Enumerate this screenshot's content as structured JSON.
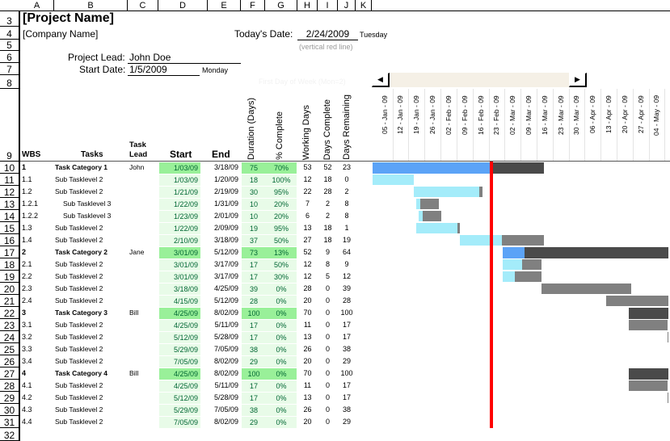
{
  "columns": [
    "A",
    "B",
    "C",
    "D",
    "E",
    "F",
    "G",
    "H",
    "I",
    "J",
    "K"
  ],
  "row_numbers": [
    "3",
    "4",
    "5",
    "6",
    "7",
    "8",
    "9",
    "10",
    "11",
    "12",
    "13",
    "14",
    "15",
    "16",
    "17",
    "18",
    "19",
    "20",
    "21",
    "22",
    "23",
    "24",
    "25",
    "26",
    "27",
    "28",
    "29",
    "30",
    "31",
    "32"
  ],
  "header": {
    "project_name": "[Project Name]",
    "company_name": "[Company Name]",
    "todays_date_label": "Today's Date:",
    "todays_date": "2/24/2009",
    "todays_day": "Tuesday",
    "red_line_note": "(vertical red line)",
    "project_lead_label": "Project Lead:",
    "project_lead": "John Doe",
    "start_date_label": "Start Date:",
    "start_date": "1/5/2009",
    "start_day": "Monday",
    "first_day_of_week": "First Day of Week (Mon=2)"
  },
  "table_headers": {
    "wbs": "WBS",
    "tasks": "Tasks",
    "task_lead": "Task Lead",
    "start": "Start",
    "end": "End",
    "duration": "Duration (Days)",
    "pct_complete": "% Complete",
    "working_days": "Working Days",
    "days_complete": "Days Complete",
    "days_remaining": "Days Remaining"
  },
  "timeline": {
    "today": "2009-02-24",
    "weeks": [
      "05 - Jan - 09",
      "12 - Jan - 09",
      "19 - Jan - 09",
      "26 - Jan - 09",
      "02 - Feb - 09",
      "09 - Feb - 09",
      "16 - Feb - 09",
      "23 - Feb - 09",
      "02 - Mar - 09",
      "09 - Mar - 09",
      "16 - Mar - 09",
      "23 - Mar - 09",
      "30 - Mar - 09",
      "06 - Apr - 09",
      "13 - Apr - 09",
      "20 - Apr - 09",
      "27 - Apr - 09",
      "04 - May - 09"
    ]
  },
  "colors": {
    "category_done": "#5ba3f7",
    "category_remaining": "#4a4a4a",
    "task_done": "#a4ecfa",
    "task_remaining": "#808080",
    "today_line": "#ff0000",
    "category_fill": "#99f099",
    "task_fill": "#e8fbe8"
  },
  "tasks": [
    {
      "wbs": "1",
      "name": "Task Category 1",
      "lead": "John",
      "start": "1/03/09",
      "end": "3/18/09",
      "duration": "75",
      "pct": "70%",
      "working": "53",
      "done": "52",
      "remaining": "23",
      "level": 1
    },
    {
      "wbs": "1.1",
      "name": "Sub Tasklevel 2",
      "lead": "",
      "start": "1/03/09",
      "end": "1/20/09",
      "duration": "18",
      "pct": "100%",
      "working": "12",
      "done": "18",
      "remaining": "0",
      "level": 2
    },
    {
      "wbs": "1.2",
      "name": "Sub Tasklevel 2",
      "lead": "",
      "start": "1/21/09",
      "end": "2/19/09",
      "duration": "30",
      "pct": "95%",
      "working": "22",
      "done": "28",
      "remaining": "2",
      "level": 2
    },
    {
      "wbs": "1.2.1",
      "name": "Sub Tasklevel 3",
      "lead": "",
      "start": "1/22/09",
      "end": "1/31/09",
      "duration": "10",
      "pct": "20%",
      "working": "7",
      "done": "2",
      "remaining": "8",
      "level": 3
    },
    {
      "wbs": "1.2.2",
      "name": "Sub Tasklevel 3",
      "lead": "",
      "start": "1/23/09",
      "end": "2/01/09",
      "duration": "10",
      "pct": "20%",
      "working": "6",
      "done": "2",
      "remaining": "8",
      "level": 3
    },
    {
      "wbs": "1.3",
      "name": "Sub Tasklevel 2",
      "lead": "",
      "start": "1/22/09",
      "end": "2/09/09",
      "duration": "19",
      "pct": "95%",
      "working": "13",
      "done": "18",
      "remaining": "1",
      "level": 2
    },
    {
      "wbs": "1.4",
      "name": "Sub Tasklevel 2",
      "lead": "",
      "start": "2/10/09",
      "end": "3/18/09",
      "duration": "37",
      "pct": "50%",
      "working": "27",
      "done": "18",
      "remaining": "19",
      "level": 2
    },
    {
      "wbs": "2",
      "name": "Task Category 2",
      "lead": "Jane",
      "start": "3/01/09",
      "end": "5/12/09",
      "duration": "73",
      "pct": "13%",
      "working": "52",
      "done": "9",
      "remaining": "64",
      "level": 1
    },
    {
      "wbs": "2.1",
      "name": "Sub Tasklevel 2",
      "lead": "",
      "start": "3/01/09",
      "end": "3/17/09",
      "duration": "17",
      "pct": "50%",
      "working": "12",
      "done": "8",
      "remaining": "9",
      "level": 2
    },
    {
      "wbs": "2.2",
      "name": "Sub Tasklevel 2",
      "lead": "",
      "start": "3/01/09",
      "end": "3/17/09",
      "duration": "17",
      "pct": "30%",
      "working": "12",
      "done": "5",
      "remaining": "12",
      "level": 2
    },
    {
      "wbs": "2.3",
      "name": "Sub Tasklevel 2",
      "lead": "",
      "start": "3/18/09",
      "end": "4/25/09",
      "duration": "39",
      "pct": "0%",
      "working": "28",
      "done": "0",
      "remaining": "39",
      "level": 2
    },
    {
      "wbs": "2.4",
      "name": "Sub Tasklevel 2",
      "lead": "",
      "start": "4/15/09",
      "end": "5/12/09",
      "duration": "28",
      "pct": "0%",
      "working": "20",
      "done": "0",
      "remaining": "28",
      "level": 2
    },
    {
      "wbs": "3",
      "name": "Task Category 3",
      "lead": "Bill",
      "start": "4/25/09",
      "end": "8/02/09",
      "duration": "100",
      "pct": "0%",
      "working": "70",
      "done": "0",
      "remaining": "100",
      "level": 1
    },
    {
      "wbs": "3.1",
      "name": "Sub Tasklevel 2",
      "lead": "",
      "start": "4/25/09",
      "end": "5/11/09",
      "duration": "17",
      "pct": "0%",
      "working": "11",
      "done": "0",
      "remaining": "17",
      "level": 2
    },
    {
      "wbs": "3.2",
      "name": "Sub Tasklevel 2",
      "lead": "",
      "start": "5/12/09",
      "end": "5/28/09",
      "duration": "17",
      "pct": "0%",
      "working": "13",
      "done": "0",
      "remaining": "17",
      "level": 2
    },
    {
      "wbs": "3.3",
      "name": "Sub Tasklevel 2",
      "lead": "",
      "start": "5/29/09",
      "end": "7/05/09",
      "duration": "38",
      "pct": "0%",
      "working": "26",
      "done": "0",
      "remaining": "38",
      "level": 2
    },
    {
      "wbs": "3.4",
      "name": "Sub Tasklevel 2",
      "lead": "",
      "start": "7/05/09",
      "end": "8/02/09",
      "duration": "29",
      "pct": "0%",
      "working": "20",
      "done": "0",
      "remaining": "29",
      "level": 2
    },
    {
      "wbs": "4",
      "name": "Task Category 4",
      "lead": "Bill",
      "start": "4/25/09",
      "end": "8/02/09",
      "duration": "100",
      "pct": "0%",
      "working": "70",
      "done": "0",
      "remaining": "100",
      "level": 1
    },
    {
      "wbs": "4.1",
      "name": "Sub Tasklevel 2",
      "lead": "",
      "start": "4/25/09",
      "end": "5/11/09",
      "duration": "17",
      "pct": "0%",
      "working": "11",
      "done": "0",
      "remaining": "17",
      "level": 2
    },
    {
      "wbs": "4.2",
      "name": "Sub Tasklevel 2",
      "lead": "",
      "start": "5/12/09",
      "end": "5/28/09",
      "duration": "17",
      "pct": "0%",
      "working": "13",
      "done": "0",
      "remaining": "17",
      "level": 2
    },
    {
      "wbs": "4.3",
      "name": "Sub Tasklevel 2",
      "lead": "",
      "start": "5/29/09",
      "end": "7/05/09",
      "duration": "38",
      "pct": "0%",
      "working": "26",
      "done": "0",
      "remaining": "38",
      "level": 2
    },
    {
      "wbs": "4.4",
      "name": "Sub Tasklevel 2",
      "lead": "",
      "start": "7/05/09",
      "end": "8/02/09",
      "duration": "29",
      "pct": "0%",
      "working": "20",
      "done": "0",
      "remaining": "29",
      "level": 2
    }
  ]
}
